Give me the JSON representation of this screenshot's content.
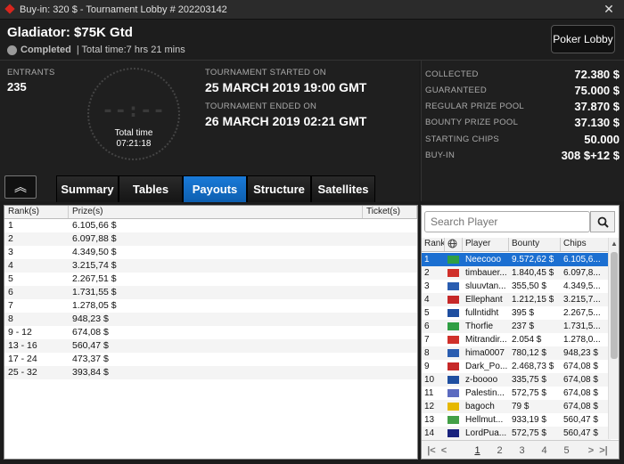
{
  "window": {
    "title": "Buy-in: 320 $ - Tournament Lobby # 202203142",
    "close_glyph": "✕"
  },
  "header": {
    "tournament_name": "Gladiator: $75K Gtd",
    "status": "Completed",
    "total_time": "| Total time:7 hrs  21 mins",
    "lobby_button": "Poker Lobby"
  },
  "info": {
    "entrants_label": "ENTRANTS",
    "entrants_value": "235",
    "clock_digits": "--:--",
    "clock_label": "Total time",
    "clock_value": "07:21:18",
    "started_label": "TOURNAMENT STARTED ON",
    "started_value": "25 MARCH 2019  19:00 GMT",
    "ended_label": "TOURNAMENT ENDED ON",
    "ended_value": "26 MARCH 2019  02:21 GMT"
  },
  "stats": [
    {
      "label": "COLLECTED",
      "value": "72.380 $"
    },
    {
      "label": "GUARANTEED",
      "value": "75.000 $"
    },
    {
      "label": "REGULAR PRIZE POOL",
      "value": "37.870 $"
    },
    {
      "label": "BOUNTY PRIZE POOL",
      "value": "37.130 $"
    },
    {
      "label": "STARTING CHIPS",
      "value": "50.000"
    },
    {
      "label": "BUY-IN",
      "value": "308 $+12 $"
    }
  ],
  "collapse_glyph": "︽",
  "tabs": [
    {
      "label": "Summary",
      "active": false
    },
    {
      "label": "Tables",
      "active": false
    },
    {
      "label": "Payouts",
      "active": true
    },
    {
      "label": "Structure",
      "active": false
    },
    {
      "label": "Satellites",
      "active": false
    }
  ],
  "payouts": {
    "headers": {
      "rank": "Rank(s)",
      "prize": "Prize(s)",
      "ticket": "Ticket(s)"
    },
    "rows": [
      {
        "rank": "1",
        "prize": "6.105,66 $"
      },
      {
        "rank": "2",
        "prize": "6.097,88 $"
      },
      {
        "rank": "3",
        "prize": "4.349,50 $"
      },
      {
        "rank": "4",
        "prize": "3.215,74 $"
      },
      {
        "rank": "5",
        "prize": "2.267,51 $"
      },
      {
        "rank": "6",
        "prize": "1.731,55 $"
      },
      {
        "rank": "7",
        "prize": "1.278,05 $"
      },
      {
        "rank": "8",
        "prize": "948,23 $"
      },
      {
        "rank": "9 - 12",
        "prize": "674,08 $"
      },
      {
        "rank": "13 - 16",
        "prize": "560,47 $"
      },
      {
        "rank": "17 - 24",
        "prize": "473,37 $"
      },
      {
        "rank": "25 - 32",
        "prize": "393,84 $"
      }
    ]
  },
  "players": {
    "search_placeholder": "Search Player",
    "headers": {
      "rank": "Rank",
      "name": "Player",
      "bounty": "Bounty",
      "chips": "Chips"
    },
    "rows": [
      {
        "rank": "1",
        "flag": "#2f9e44",
        "name": "Neecooo",
        "bounty": "9.572,62 $",
        "chips": "6.105,6...",
        "selected": true
      },
      {
        "rank": "2",
        "flag": "#d0302a",
        "name": "timbauer...",
        "bounty": "1.840,45 $",
        "chips": "6.097,8..."
      },
      {
        "rank": "3",
        "flag": "#2a5db0",
        "name": "sluuvtan...",
        "bounty": "355,50 $",
        "chips": "4.349,5..."
      },
      {
        "rank": "4",
        "flag": "#c62828",
        "name": "Ellephant",
        "bounty": "1.212,15 $",
        "chips": "3.215,7..."
      },
      {
        "rank": "5",
        "flag": "#1f4fa0",
        "name": "fullntidht",
        "bounty": "395 $",
        "chips": "2.267,5..."
      },
      {
        "rank": "6",
        "flag": "#2f9e44",
        "name": "Thorfie",
        "bounty": "237 $",
        "chips": "1.731,5..."
      },
      {
        "rank": "7",
        "flag": "#d0302a",
        "name": "Mitrandir...",
        "bounty": "2.054 $",
        "chips": "1.278,0..."
      },
      {
        "rank": "8",
        "flag": "#2a5db0",
        "name": "hima0007",
        "bounty": "780,12 $",
        "chips": "948,23 $"
      },
      {
        "rank": "9",
        "flag": "#c62828",
        "name": "Dark_Po...",
        "bounty": "2.468,73 $",
        "chips": "674,08 $"
      },
      {
        "rank": "10",
        "flag": "#1f4fa0",
        "name": "z-boooo",
        "bounty": "335,75 $",
        "chips": "674,08 $"
      },
      {
        "rank": "11",
        "flag": "#5c6bc0",
        "name": "Palestin...",
        "bounty": "572,75 $",
        "chips": "674,08 $"
      },
      {
        "rank": "12",
        "flag": "#e6b800",
        "name": "bagoch",
        "bounty": "79 $",
        "chips": "674,08 $"
      },
      {
        "rank": "13",
        "flag": "#43a047",
        "name": "Hellmut...",
        "bounty": "933,19 $",
        "chips": "560,47 $"
      },
      {
        "rank": "14",
        "flag": "#1a237e",
        "name": "LordPua...",
        "bounty": "572,75 $",
        "chips": "560,47 $"
      }
    ],
    "pager": {
      "first": "|<",
      "prev": "<",
      "pages": [
        "1",
        "2",
        "3",
        "4",
        "5"
      ],
      "current": "1",
      "next": ">",
      "last": ">|"
    }
  }
}
